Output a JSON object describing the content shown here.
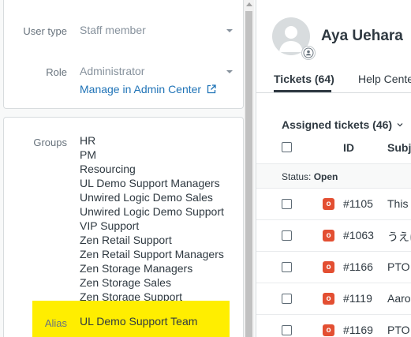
{
  "profile": {
    "user_type_label": "User type",
    "user_type_value": "Staff member",
    "role_label": "Role",
    "role_value": "Administrator",
    "admin_link": "Manage in Admin Center"
  },
  "groups": {
    "label": "Groups",
    "items": [
      "HR",
      "PM",
      "Resourcing",
      "UL Demo Support Managers",
      "Unwired Logic Demo Sales",
      "Unwired Logic Demo Support",
      "VIP Support",
      "Zen Retail Support",
      "Zen Retail Support Managers",
      "Zen Storage Managers",
      "Zen Storage Sales",
      "Zen Storage Support"
    ],
    "alias_label": "Alias",
    "alias_value": "UL Demo Support Team",
    "highlight_color": "#ffee00"
  },
  "user": {
    "name": "Aya Uehara"
  },
  "tabs": {
    "tickets": "Tickets (64)",
    "help_center": "Help Cente"
  },
  "tickets": {
    "heading": "Assigned tickets (46)",
    "col_id": "ID",
    "col_subject": "Subje",
    "status_prefix": "Status:",
    "status_value": "Open",
    "badge_letter": "o",
    "badge_color": "#e34f32",
    "rows": [
      {
        "id": "#1105",
        "subject": "This i"
      },
      {
        "id": "#1063",
        "subject": "うえは"
      },
      {
        "id": "#1166",
        "subject": "PTO I"
      },
      {
        "id": "#1119",
        "subject": "Aaron"
      },
      {
        "id": "#1169",
        "subject": "PTO I"
      }
    ]
  }
}
